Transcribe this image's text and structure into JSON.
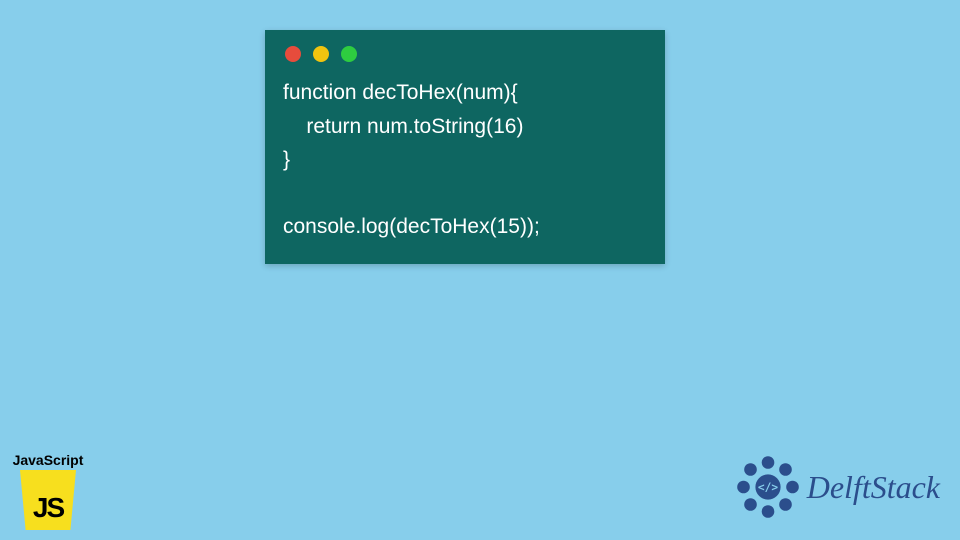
{
  "code": {
    "lines": "function decToHex(num){\n    return num.toString(16)\n}\n\nconsole.log(decToHex(15));"
  },
  "jsBadge": {
    "label": "JavaScript",
    "logoText": "JS"
  },
  "brand": {
    "name": "DelftStack"
  },
  "colors": {
    "background": "#87CEEB",
    "codeWindow": "#0e6661",
    "jsYellow": "#F7DF1E",
    "brandBlue": "#2b4e8c"
  }
}
